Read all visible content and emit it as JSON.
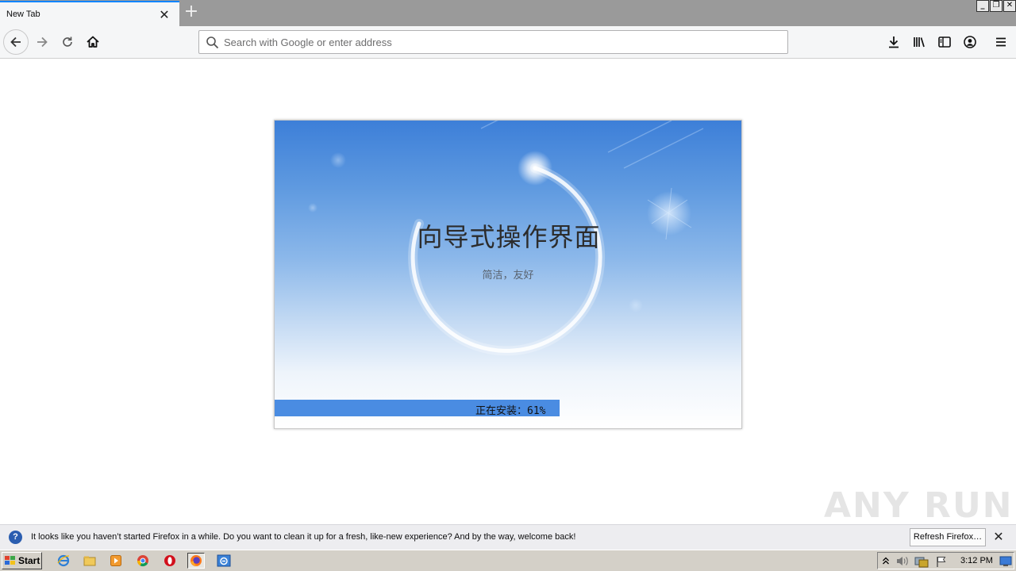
{
  "browser": {
    "tab": {
      "title": "New Tab"
    },
    "urlbar": {
      "placeholder": "Search with Google or enter address",
      "value": ""
    }
  },
  "installer": {
    "title": "向导式操作界面",
    "subtitle": "简洁，友好",
    "progress": {
      "label": "正在安装：61%",
      "percent": 61
    }
  },
  "watermark": {
    "text": "ANY RUN"
  },
  "notification": {
    "message": "It looks like you haven’t started Firefox in a while. Do you want to clean it up for a fresh, like-new experience? And by the way, welcome back!",
    "button_label": "Refresh Firefox…"
  },
  "taskbar": {
    "start_label": "Start",
    "clock": "3:12 PM"
  },
  "colors": {
    "accent": "#0a84ff",
    "progress_fill": "#4a8ce2",
    "installer_top": "#3d7fd8"
  }
}
